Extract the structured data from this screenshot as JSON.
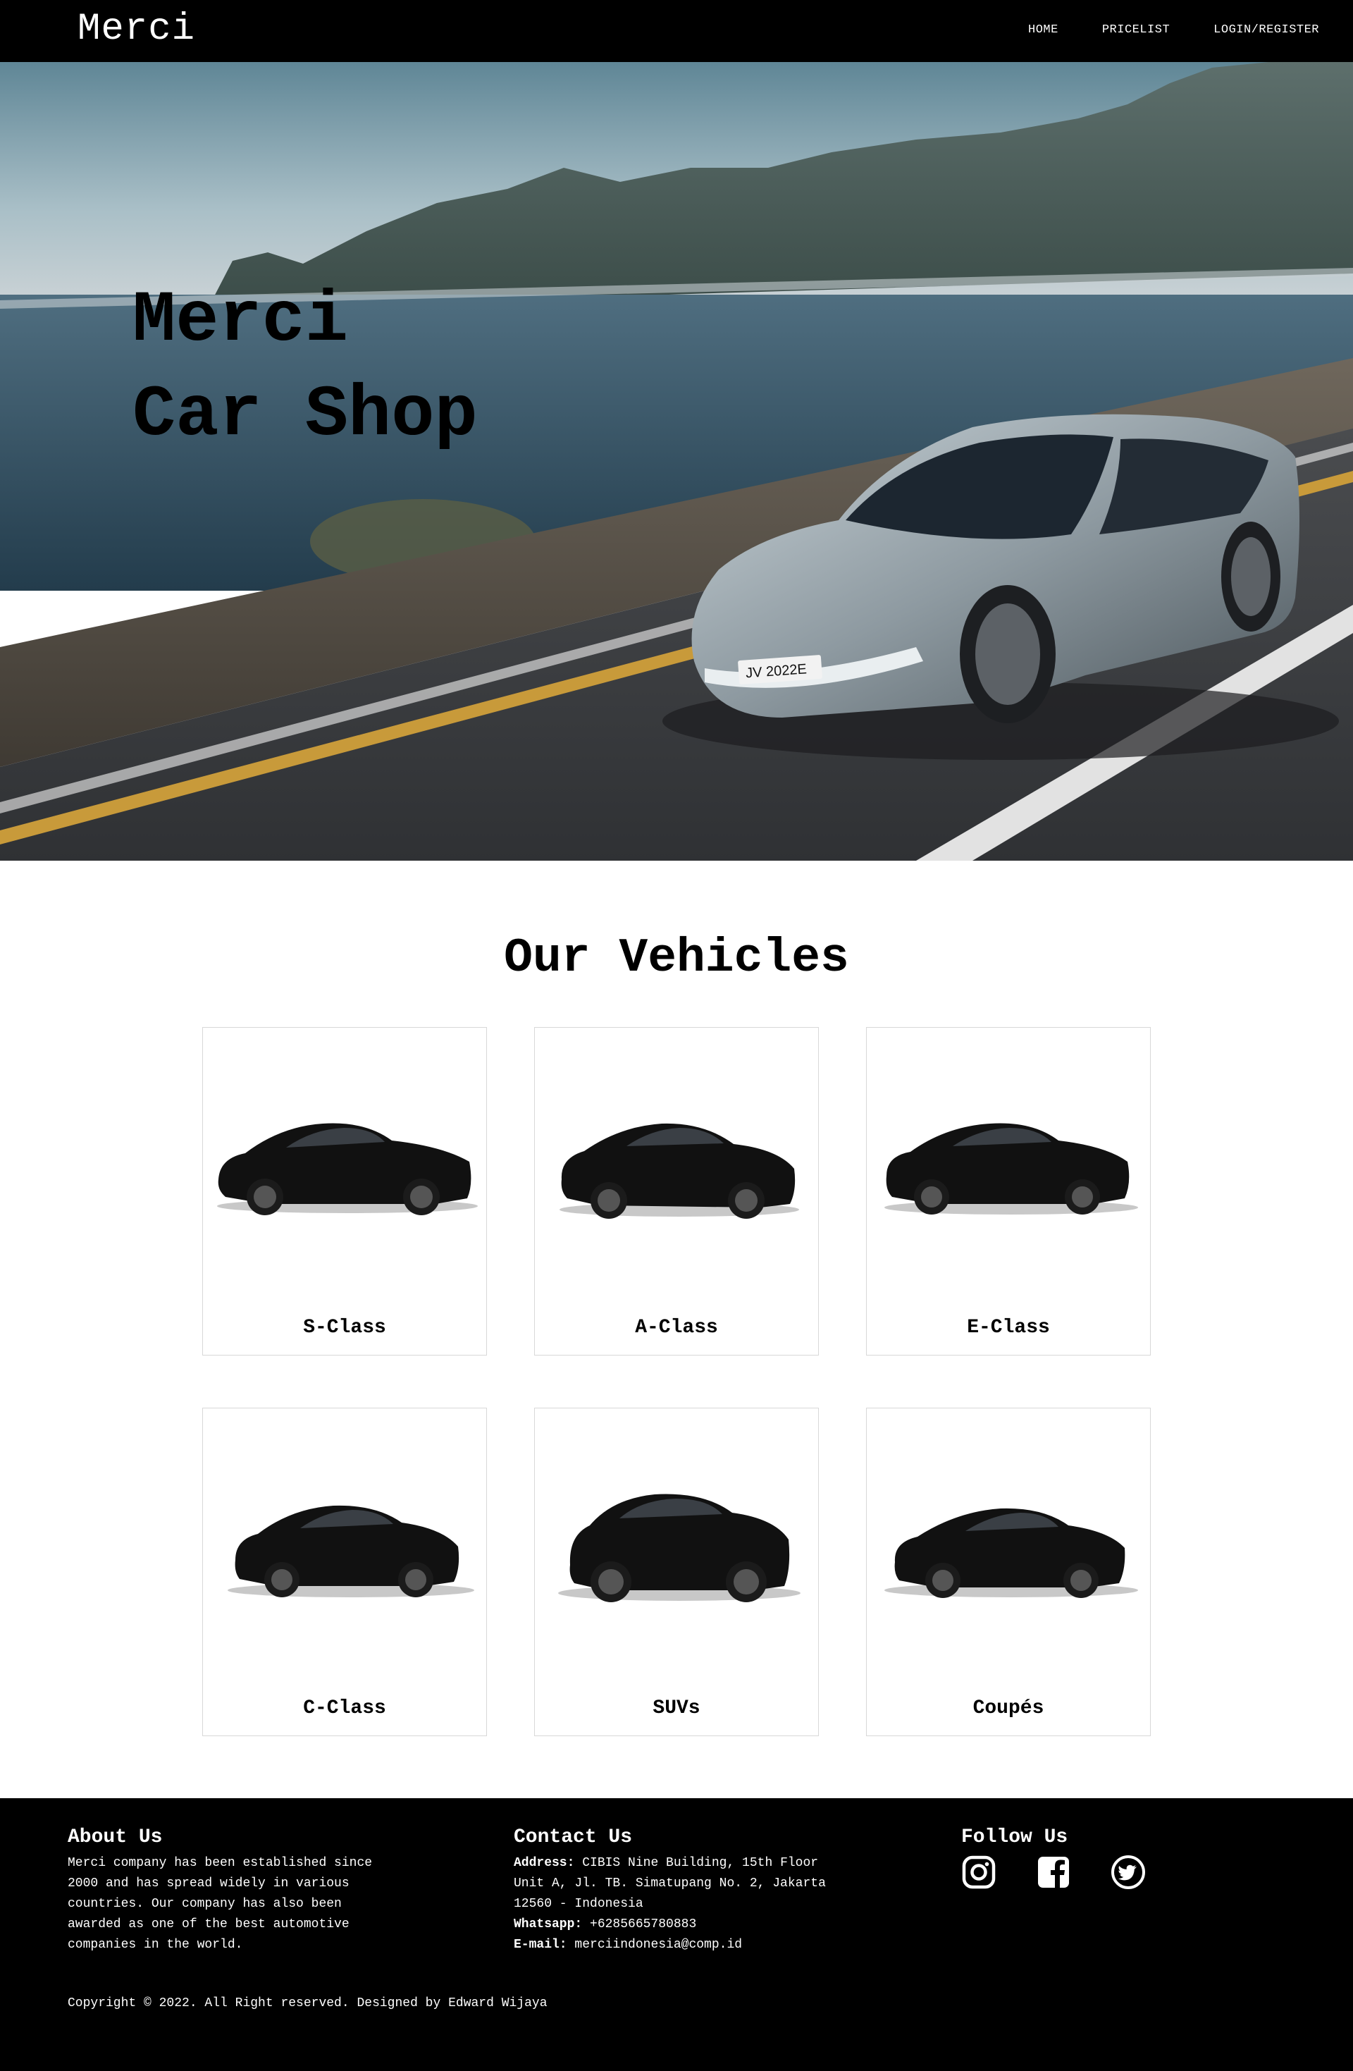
{
  "navbar": {
    "brand": "Merci",
    "links": [
      "HOME",
      "PRICELIST",
      "LOGIN/REGISTER"
    ]
  },
  "hero": {
    "title_line1": "Merci",
    "title_line2": "Car Shop",
    "plate_text": "JV 2022E"
  },
  "vehicles": {
    "title": "Our Vehicles",
    "items": [
      "S-Class",
      "A-Class",
      "E-Class",
      "C-Class",
      "SUVs",
      "Coupés"
    ]
  },
  "footer": {
    "about": {
      "heading": "About Us",
      "lines": [
        "Merci company has been established since",
        "2000 and has spread widely in various",
        "countries. Our company has also been",
        "awarded as one of the best automotive",
        "companies in the world."
      ]
    },
    "contact": {
      "heading": "Contact Us",
      "address_label": "Address:",
      "address_line1": " CIBIS Nine Building, 15th Floor",
      "address_line2": "Unit A, Jl. TB. Simatupang No. 2, Jakarta",
      "address_line3": "12560 - Indonesia",
      "whatsapp_label": "Whatsapp:",
      "whatsapp_value": " +6285665780883",
      "email_label": "E-mail:",
      "email_value": " merciindonesia@comp.id"
    },
    "follow": {
      "heading": "Follow Us",
      "icons": [
        "instagram-icon",
        "facebook-icon",
        "twitter-icon"
      ]
    },
    "copyright": "Copyright © 2022. All Right reserved. Designed by Edward Wijaya"
  },
  "colors": {
    "nav_bg": "#000000",
    "footer_bg": "#000000",
    "page_bg": "#ffffff",
    "card_border": "#d8d8d8"
  }
}
